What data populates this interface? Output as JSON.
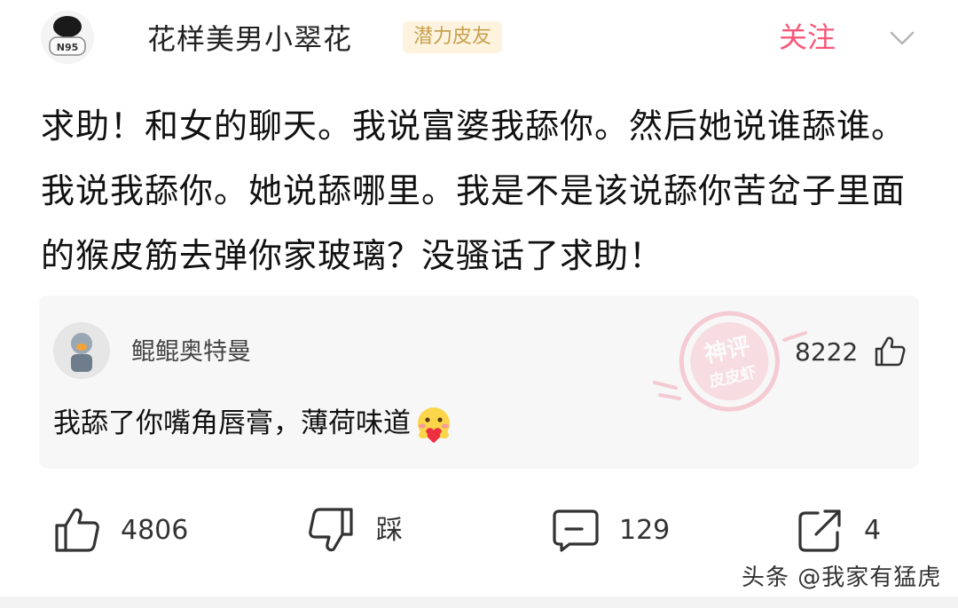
{
  "author": {
    "name": "花样美男小翠花",
    "badge": "潜力皮友",
    "avatar_text": "N95",
    "follow_label": "关注"
  },
  "post": {
    "text": "求助！和女的聊天。我说富婆我舔你。然后她说谁舔谁。我说我舔你。她说舔哪里。我是不是该说舔你苦岔子里面的猴皮筋去弹你家玻璃？没骚话了求助！"
  },
  "top_comment": {
    "username": "鲲鲲奥特曼",
    "likes": "8222",
    "text": "我舔了你嘴角唇膏，薄荷味道",
    "stamp_line1": "神评",
    "stamp_line2": "皮皮虾"
  },
  "actions": {
    "like_count": "4806",
    "dislike_label": "踩",
    "comment_count": "129",
    "share_count": "4"
  },
  "watermark": "头条 @我家有猛虎",
  "colors": {
    "accent_pink": "#f7587a",
    "badge_bg": "#fdf3df",
    "badge_text": "#c9a14f",
    "comment_bg": "#f7f7f7"
  },
  "icons": [
    "chevron-down-icon",
    "thumbs-up-icon",
    "thumbs-down-icon",
    "comment-icon",
    "share-icon",
    "heart-emoji-icon"
  ]
}
